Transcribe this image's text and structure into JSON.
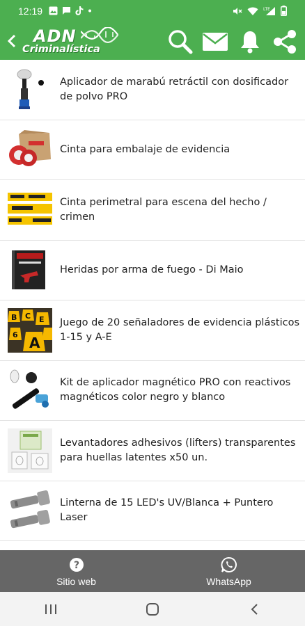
{
  "status_bar": {
    "time": "12:19",
    "icons": [
      "picture-icon",
      "message-icon",
      "tiktok-icon",
      "dot-icon",
      "mute-icon",
      "wifi-icon",
      "lte-signal-icon",
      "battery-icon"
    ]
  },
  "app_bar": {
    "logo_line1": "ADN",
    "logo_line2": "Criminalística",
    "actions": [
      "search-icon",
      "mail-icon",
      "bell-icon",
      "share-icon"
    ]
  },
  "products": [
    {
      "label": "Aplicador de marabú retráctil con dosificador de polvo PRO",
      "thumb": "brush-applicator"
    },
    {
      "label": "Cinta para embalaje de evidencia",
      "thumb": "evidence-tape"
    },
    {
      "label": "Cinta perimetral para escena del hecho / crimen",
      "thumb": "perimeter-tape"
    },
    {
      "label": "Heridas por arma de fuego - Di Maio",
      "thumb": "book"
    },
    {
      "label": "Juego de 20 señaladores de evidencia plásticos 1-15 y A-E",
      "thumb": "evidence-markers"
    },
    {
      "label": "Kit de aplicador magnético PRO con reactivos magnéticos color negro y blanco",
      "thumb": "magnetic-kit"
    },
    {
      "label": "Levantadores adhesivos (lifters) transparentes para huellas latentes x50 un.",
      "thumb": "lifters"
    },
    {
      "label": "Linterna de 15 LED's UV/Blanca + Puntero Laser",
      "thumb": "flashlights"
    }
  ],
  "bottom_bar": {
    "website_label": "Sitio web",
    "whatsapp_label": "WhatsApp"
  },
  "colors": {
    "primary": "#4caf50",
    "bottom_bar": "#666666",
    "text": "#222222"
  }
}
